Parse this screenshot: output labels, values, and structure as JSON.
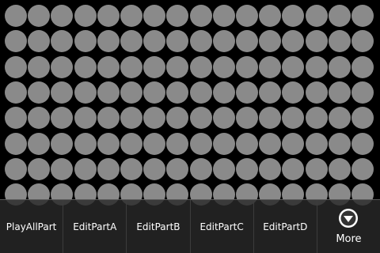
{
  "grid": {
    "columns": 16,
    "rows": 8,
    "cell_color": "#8a8a8a",
    "background_color": "#000000"
  },
  "menu": {
    "items": [
      {
        "label": "PlayAllPart"
      },
      {
        "label": "EditPartA"
      },
      {
        "label": "EditPartB"
      },
      {
        "label": "EditPartC"
      },
      {
        "label": "EditPartD"
      }
    ],
    "more": {
      "label": "More",
      "icon": "chevron-down-circle-icon"
    }
  }
}
